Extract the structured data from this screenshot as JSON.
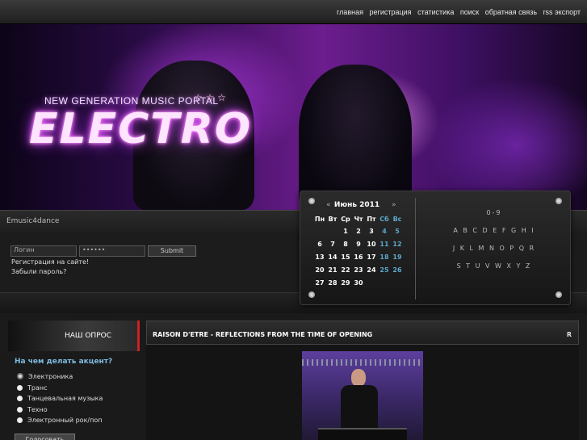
{
  "nav": [
    "главная",
    "регистрация",
    "статистика",
    "поиск",
    "обратная связь",
    "rss экспорт"
  ],
  "banner": {
    "tagline": "NEW GENERATION MUSIC PORTAL",
    "logo": "ELECTRO",
    "stars": "☆ ☆ ☆"
  },
  "site_name": "Emusic4dance",
  "login": {
    "login_value": "Логин",
    "password_value": "••••••",
    "submit_label": "Submit",
    "register_link": "Регистрация на сайте!",
    "forgot_link": "Забыли пароль?"
  },
  "calendar": {
    "prev": "«",
    "next": "»",
    "month": "Июнь 2011",
    "weekdays": [
      "Пн",
      "Вт",
      "Ср",
      "Чт",
      "Пт",
      "Сб",
      "Вс"
    ],
    "weeks": [
      [
        "",
        "",
        "1",
        "2",
        "3",
        "4",
        "5"
      ],
      [
        "6",
        "7",
        "8",
        "9",
        "10",
        "11",
        "12"
      ],
      [
        "13",
        "14",
        "15",
        "16",
        "17",
        "18",
        "19"
      ],
      [
        "20",
        "21",
        "22",
        "23",
        "24",
        "25",
        "26"
      ],
      [
        "27",
        "28",
        "29",
        "30",
        "",
        "",
        ""
      ]
    ]
  },
  "alphabet": {
    "digits": "0-9",
    "row1": "A B C D E F G H I",
    "row2": "J K L M N O P Q R",
    "row3": "S T U V W X Y Z"
  },
  "poll": {
    "title": "НАШ ОПРОС",
    "question": "На чем делать акцент?",
    "options": [
      "Электроника",
      "Транс",
      "Танцевальная музыка",
      "Техно",
      "Электронный рок/поп"
    ],
    "vote_label": "Голосовать"
  },
  "article": {
    "title": "RAISON D'ETRE - REFLECTIONS FROM THE TIME OF OPENING",
    "corner": "R"
  }
}
